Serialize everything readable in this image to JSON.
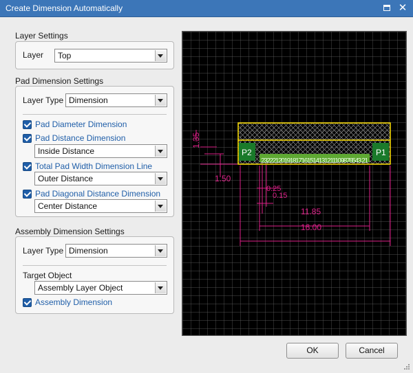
{
  "window": {
    "title": "Create Dimension Automatically"
  },
  "layer_settings": {
    "title": "Layer Settings",
    "layer_label": "Layer",
    "layer_value": "Top"
  },
  "pad_settings": {
    "title": "Pad Dimension Settings",
    "layer_type_label": "Layer Type",
    "layer_type_value": "Dimension",
    "pad_diameter_label": "Pad Diameter Dimension",
    "pad_diameter_checked": true,
    "pad_distance_label": "Pad Distance Dimension",
    "pad_distance_checked": true,
    "pad_distance_mode": "Inside Distance",
    "total_width_label": "Total Pad Width Dimension Line",
    "total_width_checked": true,
    "total_width_mode": "Outer Distance",
    "diagonal_label": "Pad Diagonal Distance Dimension",
    "diagonal_checked": true,
    "diagonal_mode": "Center Distance"
  },
  "assembly_settings": {
    "title": "Assembly Dimension Settings",
    "layer_type_label": "Layer Type",
    "layer_type_value": "Dimension",
    "target_label": "Target Object",
    "target_value": "Assembly Layer Object",
    "assembly_dim_label": "Assembly Dimension",
    "assembly_dim_checked": true
  },
  "preview": {
    "pad_left": "P2",
    "pad_right": "P1",
    "pin_numbers": "23222120191817161514131211109876543 21",
    "dim_135": "1.35",
    "dim_150": "1.50",
    "dim_025": "0.25",
    "dim_015": "0.15",
    "dim_1185": "11.85",
    "dim_1600": "16.00",
    "colors": {
      "dimension": "#e0208a",
      "outline": "#ffe000",
      "pad": "#1a7a2a",
      "grid": "#6a6a6a"
    }
  },
  "buttons": {
    "ok": "OK",
    "cancel": "Cancel"
  }
}
